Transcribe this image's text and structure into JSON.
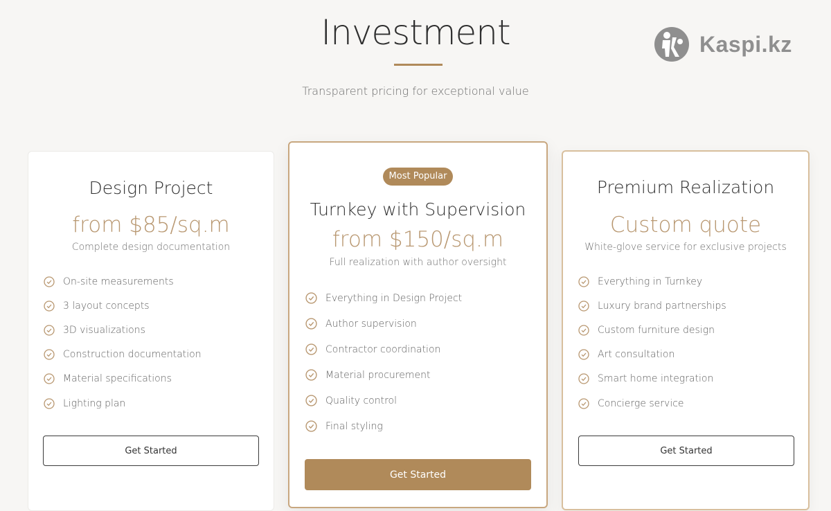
{
  "header": {
    "title": "Investment",
    "subtitle": "Transparent pricing for exceptional value"
  },
  "brand": {
    "name": "Kaspi.kz",
    "icon": "kaspi-logo"
  },
  "accent_color": "#b08a5a",
  "plans": [
    {
      "name": "Design Project",
      "price": "from $85/sq.m",
      "description": "Complete design documentation",
      "features": [
        "On-site measurements",
        "3 layout concepts",
        "3D visualizations",
        "Construction documentation",
        "Material specifications",
        "Lighting plan"
      ],
      "cta": "Get Started"
    },
    {
      "badge": "Most Popular",
      "name": "Turnkey with Supervision",
      "price": "from $150/sq.m",
      "description": "Full realization with author oversight",
      "features": [
        "Everything in Design Project",
        "Author supervision",
        "Contractor coordination",
        "Material procurement",
        "Quality control",
        "Final styling"
      ],
      "cta": "Get Started"
    },
    {
      "name": "Premium Realization",
      "price": "Custom quote",
      "description": "White-glove service for exclusive projects",
      "features": [
        "Everything in Turnkey",
        "Luxury brand partnerships",
        "Custom furniture design",
        "Art consultation",
        "Smart home integration",
        "Concierge service"
      ],
      "cta": "Get Started"
    }
  ]
}
